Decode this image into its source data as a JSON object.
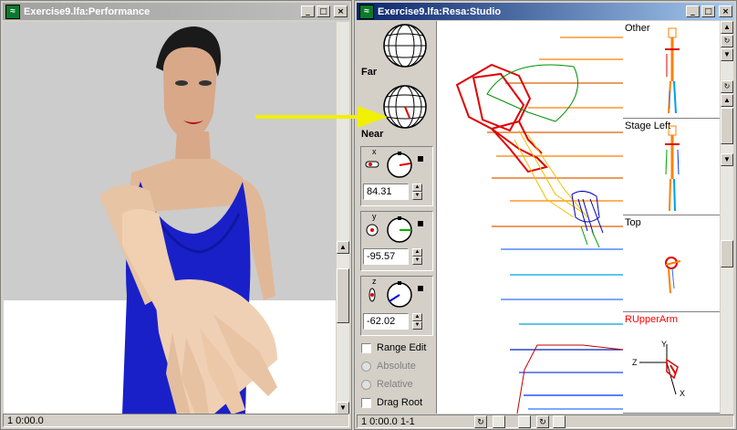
{
  "left_window": {
    "title": "Exercise9.lfa:Performance",
    "status": "1 0:00.0"
  },
  "right_window": {
    "title": "Exercise9.lfa:Resa:Studio",
    "status": "1 0:00.0 1-1",
    "far_label": "Far",
    "near_label": "Near",
    "x_axis_label": "x",
    "y_axis_label": "y",
    "z_axis_label": "z",
    "x_value": "84.31",
    "y_value": "-95.57",
    "z_value": "-62.02",
    "range_edit_label": "Range Edit",
    "absolute_label": "Absolute",
    "relative_label": "Relative",
    "drag_root_label": "Drag Root",
    "views": [
      {
        "label": "Other"
      },
      {
        "label": "Stage Left"
      },
      {
        "label": "Top"
      },
      {
        "label": "RUpperArm",
        "color": "#ff0000"
      }
    ],
    "axis_labels": {
      "x": "X",
      "y": "Y",
      "z": "Z"
    }
  },
  "colors": {
    "active_title": "#0a246a",
    "inactive_title": "#a0a0a0",
    "dress": "#1a20c8",
    "skin": "#e8c0a0",
    "arrow": "#f0f000"
  },
  "title_buttons": {
    "minimize": "_",
    "maximize": "□",
    "close": "×"
  }
}
